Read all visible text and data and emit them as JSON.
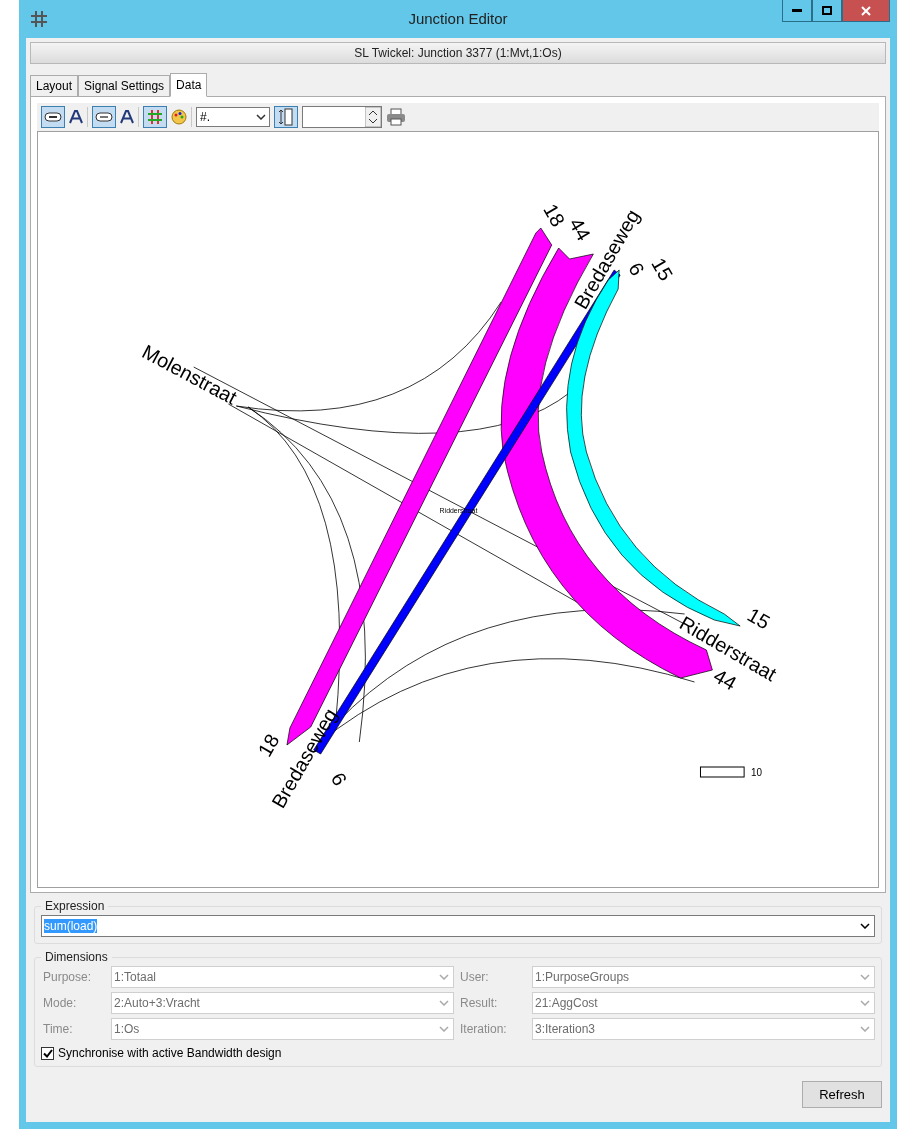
{
  "window": {
    "title": "Junction Editor"
  },
  "header": "SL Twickel: Junction 3377 (1:Mvt,1:Os)",
  "tabs": [
    {
      "label": "Layout",
      "selected": false
    },
    {
      "label": "Signal Settings",
      "selected": false
    },
    {
      "label": "Data",
      "selected": true
    }
  ],
  "toolbar": [
    {
      "kind": "label-toggle",
      "selected": true
    },
    {
      "kind": "font"
    },
    {
      "kind": "value-toggle",
      "selected": true
    },
    {
      "kind": "font"
    },
    {
      "kind": "grid-toggle",
      "selected": true
    },
    {
      "kind": "palette"
    },
    {
      "kind": "format",
      "value": "#."
    },
    {
      "kind": "width-toggle",
      "selected": true
    },
    {
      "kind": "spin"
    },
    {
      "kind": "print"
    }
  ],
  "diagram": {
    "flows": [
      {
        "color": "#ff00ff",
        "start_value": "18",
        "end_value": "18"
      },
      {
        "color": "#ff00ff",
        "start_value": "44",
        "end_value": "44"
      },
      {
        "color": "#0000ff",
        "start_value": "6",
        "end_value": "6"
      },
      {
        "color": "#00ffff",
        "start_value": "15",
        "end_value": "15"
      }
    ],
    "roads": [
      "Bredaseweg",
      "Molenstraat",
      "Ridderstraat",
      "Bredaseweg"
    ],
    "center_label": "Ridderstraat",
    "legend_label": "10"
  },
  "expression": {
    "label": "Expression",
    "value": "sum(load)"
  },
  "dimensions": {
    "label": "Dimensions",
    "fields": [
      {
        "label": "Purpose:",
        "value": "1:Totaal",
        "disabled": true
      },
      {
        "label": "User:",
        "value": "1:PurposeGroups",
        "disabled": true
      },
      {
        "label": "Mode:",
        "value": "2:Auto+3:Vracht",
        "disabled": true
      },
      {
        "label": "Result:",
        "value": "21:AggCost",
        "disabled": true
      },
      {
        "label": "Time:",
        "value": "1:Os",
        "disabled": true
      },
      {
        "label": "Iteration:",
        "value": "3:Iteration3",
        "disabled": true
      }
    ]
  },
  "sync": {
    "label": "Synchronise with active Bandwidth design",
    "checked": true
  },
  "refresh": "Refresh"
}
